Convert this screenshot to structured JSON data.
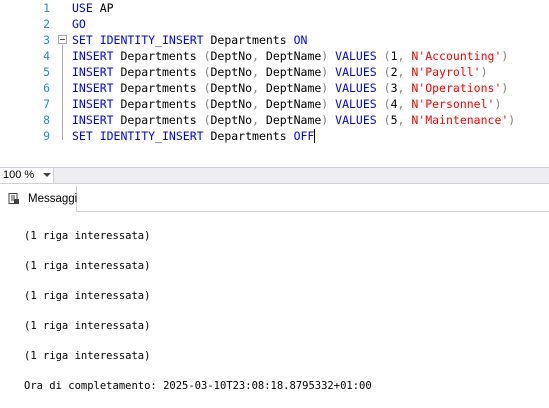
{
  "editor": {
    "lines": [
      {
        "num": "1",
        "tokens": [
          {
            "t": "USE ",
            "c": "kw"
          },
          {
            "t": "AP",
            "c": ""
          }
        ]
      },
      {
        "num": "2",
        "tokens": [
          {
            "t": "GO",
            "c": "kw"
          }
        ]
      },
      {
        "num": "3",
        "tokens": [
          {
            "t": "SET IDENTITY_INSERT ",
            "c": "kw"
          },
          {
            "t": "Departments ",
            "c": ""
          },
          {
            "t": "ON",
            "c": "kw"
          }
        ]
      },
      {
        "num": "4",
        "tokens": [
          {
            "t": "INSERT ",
            "c": "kw"
          },
          {
            "t": "Departments ",
            "c": ""
          },
          {
            "t": "(",
            "c": "op"
          },
          {
            "t": "DeptNo",
            "c": ""
          },
          {
            "t": ", ",
            "c": "op"
          },
          {
            "t": "DeptName",
            "c": ""
          },
          {
            "t": ") ",
            "c": "op"
          },
          {
            "t": "VALUES ",
            "c": "kw"
          },
          {
            "t": "(",
            "c": "op"
          },
          {
            "t": "1",
            "c": ""
          },
          {
            "t": ", ",
            "c": "op"
          },
          {
            "t": "N'Accounting'",
            "c": "str"
          },
          {
            "t": ")",
            "c": "op"
          }
        ]
      },
      {
        "num": "5",
        "tokens": [
          {
            "t": "INSERT ",
            "c": "kw"
          },
          {
            "t": "Departments ",
            "c": ""
          },
          {
            "t": "(",
            "c": "op"
          },
          {
            "t": "DeptNo",
            "c": ""
          },
          {
            "t": ", ",
            "c": "op"
          },
          {
            "t": "DeptName",
            "c": ""
          },
          {
            "t": ") ",
            "c": "op"
          },
          {
            "t": "VALUES ",
            "c": "kw"
          },
          {
            "t": "(",
            "c": "op"
          },
          {
            "t": "2",
            "c": ""
          },
          {
            "t": ", ",
            "c": "op"
          },
          {
            "t": "N'Payroll'",
            "c": "str"
          },
          {
            "t": ")",
            "c": "op"
          }
        ]
      },
      {
        "num": "6",
        "tokens": [
          {
            "t": "INSERT ",
            "c": "kw"
          },
          {
            "t": "Departments ",
            "c": ""
          },
          {
            "t": "(",
            "c": "op"
          },
          {
            "t": "DeptNo",
            "c": ""
          },
          {
            "t": ", ",
            "c": "op"
          },
          {
            "t": "DeptName",
            "c": ""
          },
          {
            "t": ") ",
            "c": "op"
          },
          {
            "t": "VALUES ",
            "c": "kw"
          },
          {
            "t": "(",
            "c": "op"
          },
          {
            "t": "3",
            "c": ""
          },
          {
            "t": ", ",
            "c": "op"
          },
          {
            "t": "N'Operations'",
            "c": "str"
          },
          {
            "t": ")",
            "c": "op"
          }
        ]
      },
      {
        "num": "7",
        "tokens": [
          {
            "t": "INSERT ",
            "c": "kw"
          },
          {
            "t": "Departments ",
            "c": ""
          },
          {
            "t": "(",
            "c": "op"
          },
          {
            "t": "DeptNo",
            "c": ""
          },
          {
            "t": ", ",
            "c": "op"
          },
          {
            "t": "DeptName",
            "c": ""
          },
          {
            "t": ") ",
            "c": "op"
          },
          {
            "t": "VALUES ",
            "c": "kw"
          },
          {
            "t": "(",
            "c": "op"
          },
          {
            "t": "4",
            "c": ""
          },
          {
            "t": ", ",
            "c": "op"
          },
          {
            "t": "N'Personnel'",
            "c": "str"
          },
          {
            "t": ")",
            "c": "op"
          }
        ]
      },
      {
        "num": "8",
        "tokens": [
          {
            "t": "INSERT ",
            "c": "kw"
          },
          {
            "t": "Departments ",
            "c": ""
          },
          {
            "t": "(",
            "c": "op"
          },
          {
            "t": "DeptNo",
            "c": ""
          },
          {
            "t": ", ",
            "c": "op"
          },
          {
            "t": "DeptName",
            "c": ""
          },
          {
            "t": ") ",
            "c": "op"
          },
          {
            "t": "VALUES ",
            "c": "kw"
          },
          {
            "t": "(",
            "c": "op"
          },
          {
            "t": "5",
            "c": ""
          },
          {
            "t": ", ",
            "c": "op"
          },
          {
            "t": "N'Maintenance'",
            "c": "str"
          },
          {
            "t": ")",
            "c": "op"
          }
        ]
      },
      {
        "num": "9",
        "tokens": [
          {
            "t": "SET IDENTITY_INSERT ",
            "c": "kw"
          },
          {
            "t": "Departments ",
            "c": ""
          },
          {
            "t": "OFF",
            "c": "kw"
          }
        ]
      }
    ]
  },
  "zoom": {
    "value": "100 %"
  },
  "results": {
    "tab_label": "Messaggi",
    "tab_icon": "messages-icon",
    "messages": [
      "(1 riga interessata)",
      "(1 riga interessata)",
      "(1 riga interessata)",
      "(1 riga interessata)",
      "(1 riga interessata)",
      "Ora di completamento: 2025-03-10T23:08:18.8795332+01:00"
    ]
  },
  "colors": {
    "keyword": "#0000ff",
    "string": "#ff0000",
    "operator": "#808080",
    "line_number": "#2b91af"
  }
}
